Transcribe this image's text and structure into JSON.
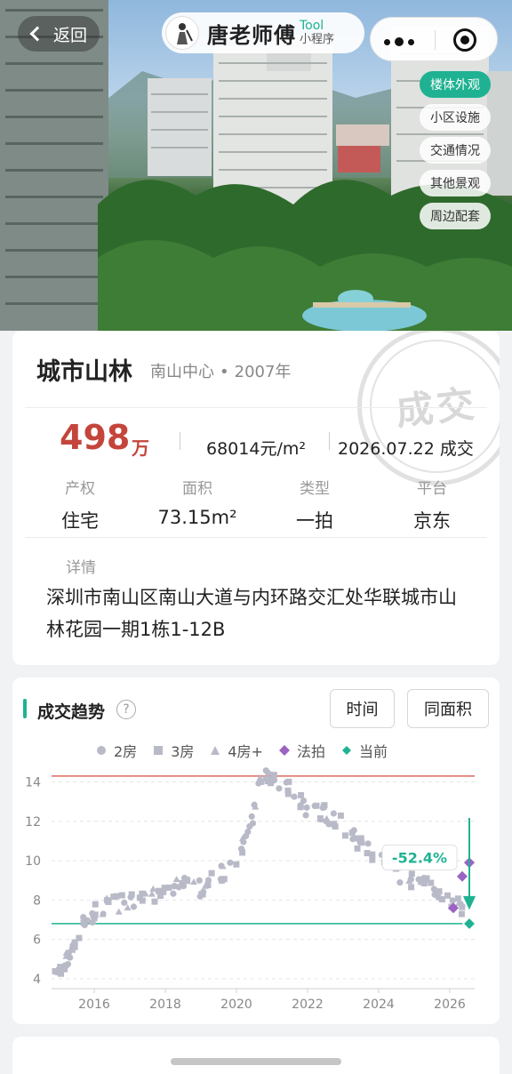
{
  "topbar": {
    "back_label": "返回",
    "app_name": "唐老师傅",
    "app_tag_top": "Tool",
    "app_tag_bottom": "小程序"
  },
  "photo_tabs": [
    {
      "label": "楼体外观",
      "active": true
    },
    {
      "label": "小区设施",
      "active": false
    },
    {
      "label": "交通情况",
      "active": false
    },
    {
      "label": "其他景观",
      "active": false
    },
    {
      "label": "周边配套",
      "active": false
    }
  ],
  "listing": {
    "name": "城市山林",
    "area": "南山中心",
    "separator": "•",
    "year": "2007年",
    "stamp": "成交",
    "price": "498",
    "price_unit": "万",
    "unit_price": "68014元/m²",
    "deal": "2026.07.22 成交",
    "attrs": [
      {
        "label": "产权",
        "value": "住宅"
      },
      {
        "label": "面积",
        "value": "73.15m²"
      },
      {
        "label": "类型",
        "value": "一拍"
      },
      {
        "label": "平台",
        "value": "京东"
      }
    ],
    "detail_label": "详情",
    "detail_text": "深圳市南山区南山大道与内环路交汇处华联城市山林花园一期1栋1-12B"
  },
  "trend": {
    "title": "成交趋势",
    "help_icon": "?",
    "btn_time": "时间",
    "btn_same_area": "同面积",
    "colors": {
      "accent": "#1fb292",
      "price": "#c4453b",
      "auction": "#9b63c4",
      "dots": "#b9bac8"
    }
  },
  "chart_data": {
    "type": "scatter",
    "legend": [
      {
        "name": "2房",
        "marker": "circle",
        "color": "#b9bac8"
      },
      {
        "name": "3房",
        "marker": "square",
        "color": "#b9bac8"
      },
      {
        "name": "4房+",
        "marker": "triangle",
        "color": "#b9bac8"
      },
      {
        "name": "法拍",
        "marker": "diamond",
        "color": "#9b63c4"
      },
      {
        "name": "当前",
        "marker": "diamond",
        "color": "#1fb292"
      }
    ],
    "x_ticks": [
      "2016",
      "2018",
      "2020",
      "2022",
      "2024",
      "2026"
    ],
    "y_ticks": [
      "4",
      "6",
      "8",
      "10",
      "12",
      "14"
    ],
    "xlim": [
      2014.8,
      2026.7
    ],
    "ylim": [
      3.5,
      14.7
    ],
    "max_line": 14.3,
    "current_line": 6.8,
    "change_label": "-52.4%",
    "current_point": {
      "x": 2026.55,
      "y": 6.8
    },
    "auction_points": [
      {
        "x": 2026.1,
        "y": 7.6
      },
      {
        "x": 2026.35,
        "y": 9.2
      },
      {
        "x": 2026.55,
        "y": 9.9
      }
    ],
    "trend_points": [
      {
        "x": 2014.9,
        "y": 4.0
      },
      {
        "x": 2015.1,
        "y": 4.6
      },
      {
        "x": 2015.3,
        "y": 5.2
      },
      {
        "x": 2015.6,
        "y": 6.6
      },
      {
        "x": 2016.0,
        "y": 7.3
      },
      {
        "x": 2016.4,
        "y": 7.8
      },
      {
        "x": 2017.0,
        "y": 7.9
      },
      {
        "x": 2017.5,
        "y": 8.0
      },
      {
        "x": 2018.0,
        "y": 8.4
      },
      {
        "x": 2018.5,
        "y": 8.9
      },
      {
        "x": 2019.0,
        "y": 8.6
      },
      {
        "x": 2019.5,
        "y": 9.2
      },
      {
        "x": 2020.0,
        "y": 10.2
      },
      {
        "x": 2020.4,
        "y": 11.6
      },
      {
        "x": 2020.7,
        "y": 14.2
      },
      {
        "x": 2021.0,
        "y": 14.3
      },
      {
        "x": 2021.5,
        "y": 13.8
      },
      {
        "x": 2022.0,
        "y": 12.6
      },
      {
        "x": 2022.5,
        "y": 12.4
      },
      {
        "x": 2023.0,
        "y": 11.8
      },
      {
        "x": 2023.5,
        "y": 10.7
      },
      {
        "x": 2024.0,
        "y": 10.2
      },
      {
        "x": 2024.5,
        "y": 9.4
      },
      {
        "x": 2025.0,
        "y": 9.0
      },
      {
        "x": 2025.5,
        "y": 8.8
      },
      {
        "x": 2026.0,
        "y": 8.0
      },
      {
        "x": 2026.4,
        "y": 7.4
      }
    ]
  }
}
